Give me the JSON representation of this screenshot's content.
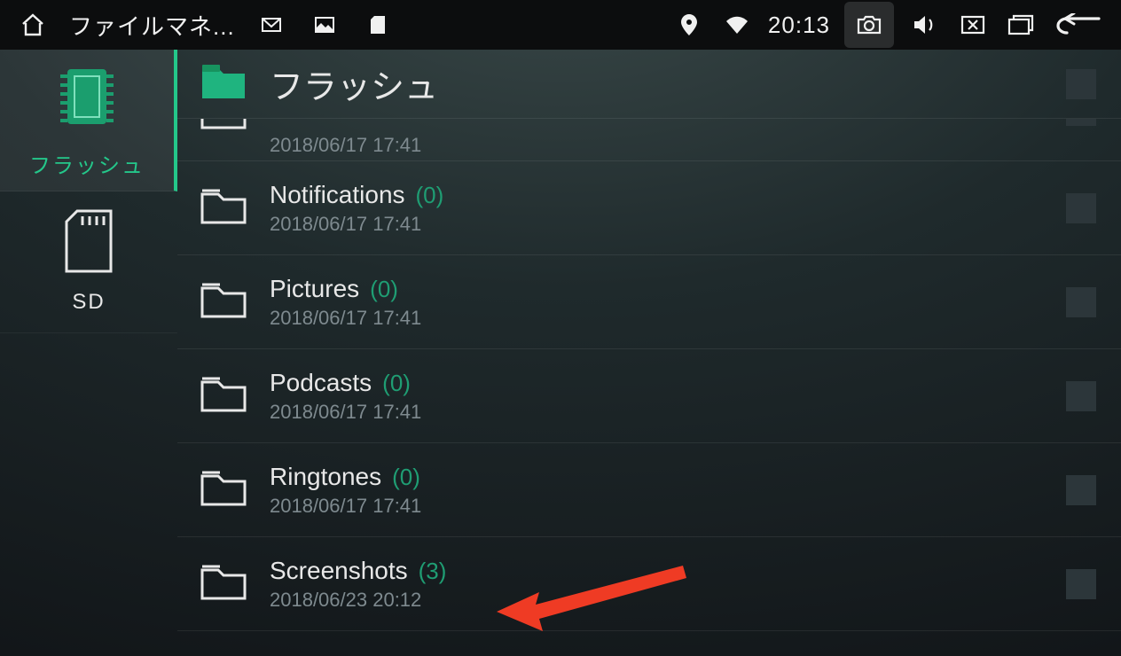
{
  "statusbar": {
    "app_title": "ファイルマネ...",
    "clock": "20:13"
  },
  "sidebar": {
    "items": [
      {
        "label": "フラッシュ",
        "selected": true,
        "icon": "chip"
      },
      {
        "label": "SD",
        "selected": false,
        "icon": "sd"
      }
    ]
  },
  "header": {
    "title": "フラッシュ"
  },
  "rows": [
    {
      "partial": true,
      "name": "",
      "count": "",
      "date": "2018/06/17 17:41"
    },
    {
      "name": "Notifications",
      "count": "(0)",
      "date": "2018/06/17 17:41"
    },
    {
      "name": "Pictures",
      "count": "(0)",
      "date": "2018/06/17 17:41"
    },
    {
      "name": "Podcasts",
      "count": "(0)",
      "date": "2018/06/17 17:41"
    },
    {
      "name": "Ringtones",
      "count": "(0)",
      "date": "2018/06/17 17:41"
    },
    {
      "name": "Screenshots",
      "count": "(3)",
      "date": "2018/06/23 20:12"
    }
  ],
  "colors": {
    "accent": "#24c78a"
  }
}
